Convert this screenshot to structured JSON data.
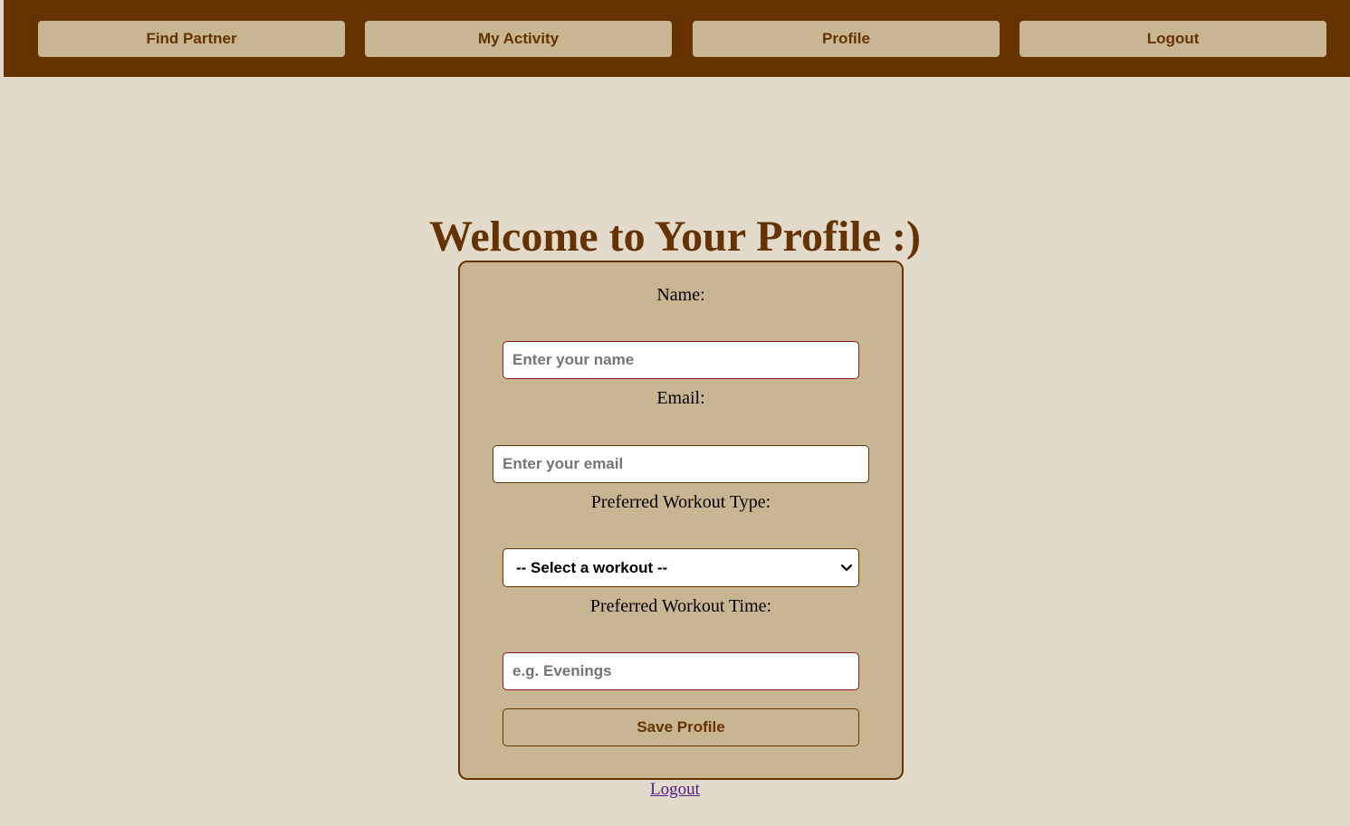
{
  "nav": {
    "items": [
      {
        "label": "Find Partner"
      },
      {
        "label": "My Activity"
      },
      {
        "label": "Profile"
      },
      {
        "label": "Logout"
      }
    ]
  },
  "page": {
    "title": "Welcome to Your Profile :)"
  },
  "form": {
    "name_label": "Name:",
    "name_placeholder": "Enter your name",
    "email_label": "Email:",
    "email_placeholder": "Enter your email",
    "workout_type_label": "Preferred Workout Type:",
    "workout_type_selected": "-- Select a workout --",
    "workout_time_label": "Preferred Workout Time:",
    "workout_time_placeholder": "e.g. Evenings",
    "save_label": "Save Profile"
  },
  "footer": {
    "logout_link": "Logout"
  },
  "colors": {
    "nav_background": "#663300",
    "page_background": "#e2dbcb",
    "card_background": "#c8b591",
    "accent_text": "#663300",
    "link": "#551a8b"
  }
}
